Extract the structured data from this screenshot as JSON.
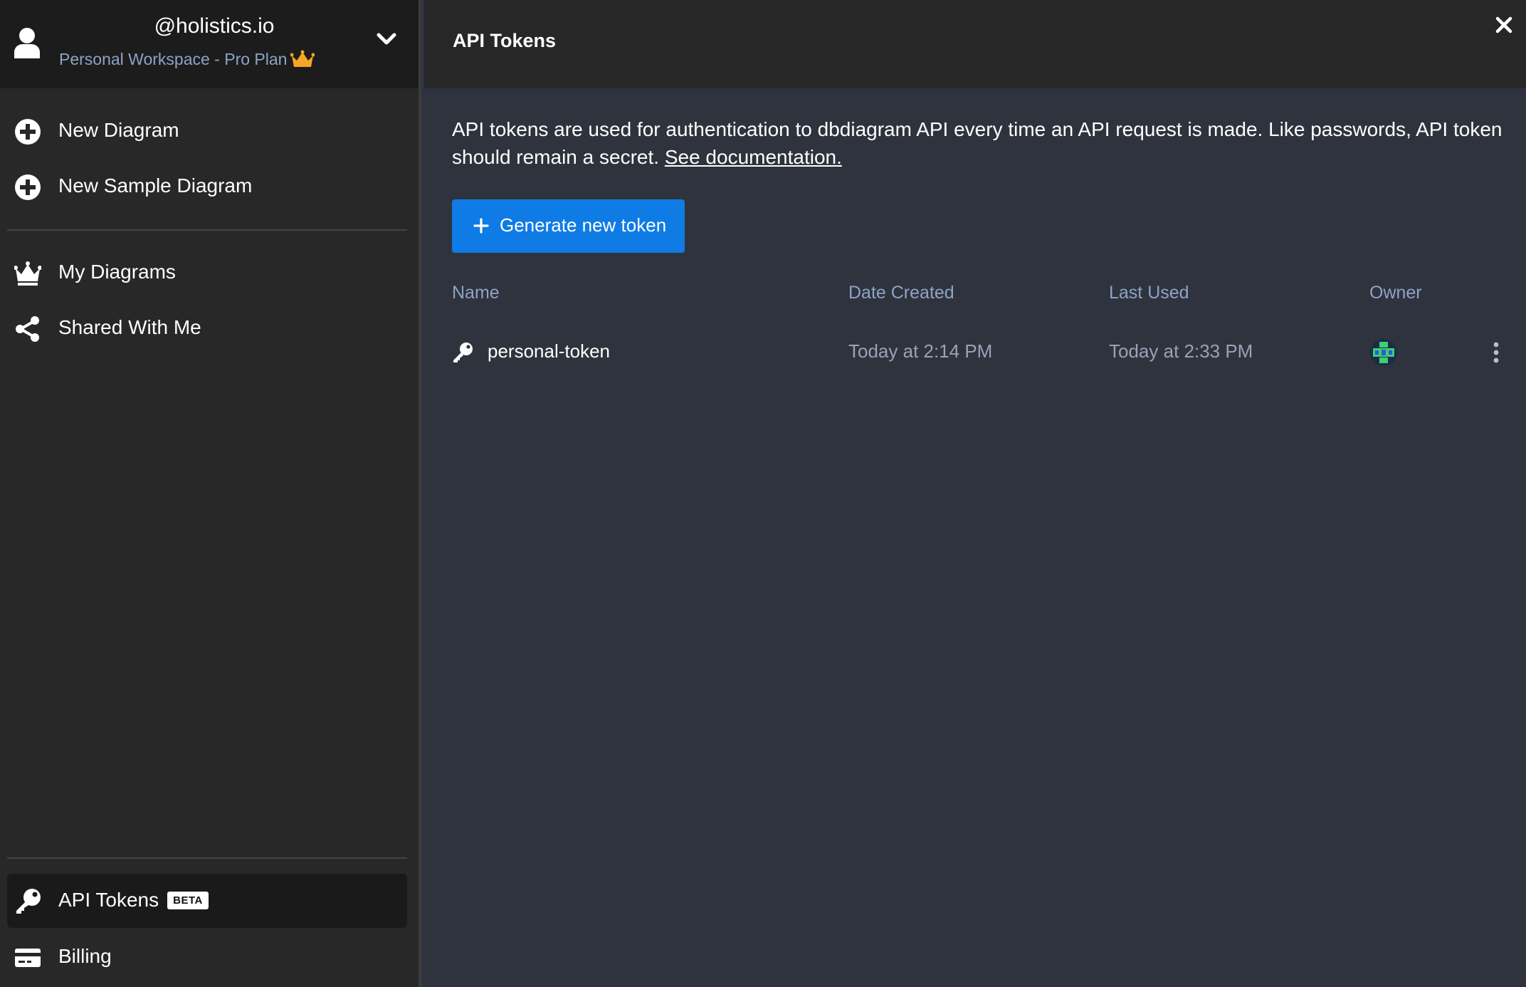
{
  "workspace": {
    "name": "@holistics.io",
    "plan": "Personal Workspace - Pro Plan"
  },
  "sidebar": {
    "items": [
      {
        "label": "New Diagram",
        "icon": "plus-circle-icon"
      },
      {
        "label": "New Sample Diagram",
        "icon": "plus-circle-icon"
      },
      {
        "label": "My Diagrams",
        "icon": "crown-icon"
      },
      {
        "label": "Shared With Me",
        "icon": "share-icon"
      }
    ],
    "bottom_items": [
      {
        "label": "API Tokens",
        "badge": "BETA",
        "icon": "key-icon",
        "active": true
      },
      {
        "label": "Billing",
        "icon": "credit-card-icon"
      }
    ]
  },
  "main": {
    "title": "API Tokens",
    "description": "API tokens are used for authentication to dbdiagram API every time an API request is made. Like passwords, API token should remain a secret.",
    "doc_link": "See documentation.",
    "generate_button": "Generate new token",
    "table": {
      "headers": {
        "name": "Name",
        "date_created": "Date Created",
        "last_used": "Last Used",
        "owner": "Owner"
      },
      "rows": [
        {
          "name": "personal-token",
          "date_created": "Today at 2:14 PM",
          "last_used": "Today at 2:33 PM"
        }
      ]
    }
  },
  "colors": {
    "sidebar_bg": "#282828",
    "header_bg": "#1c1c1c",
    "main_bg": "#2f333d",
    "accent": "#0f7be5",
    "muted_text": "#8ea3c7",
    "crown": "#f5a623"
  }
}
